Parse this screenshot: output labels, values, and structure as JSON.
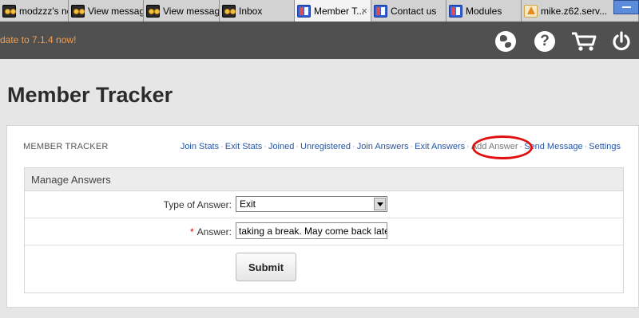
{
  "browser": {
    "tabs": [
      {
        "label": "modzzz's ne...",
        "icon": "eye-icon",
        "active": false
      },
      {
        "label": "View message",
        "icon": "eye-icon",
        "active": false
      },
      {
        "label": "View message",
        "icon": "eye-icon",
        "active": false
      },
      {
        "label": "Inbox",
        "icon": "eye-icon",
        "active": false
      },
      {
        "label": "Member T...",
        "icon": "window-icon",
        "active": true,
        "close": "×"
      },
      {
        "label": "Contact us",
        "icon": "window-icon",
        "active": false
      },
      {
        "label": "Modules",
        "icon": "window-icon",
        "active": false
      },
      {
        "label": "mike.z62.serv...",
        "icon": "phpmyadmin-icon",
        "active": false
      }
    ]
  },
  "appbar": {
    "update_notice": "date to 7.1.4 now!",
    "icons": [
      "globe-icon",
      "help-icon",
      "cart-icon",
      "power-icon"
    ],
    "help_glyph": "?"
  },
  "page": {
    "title": "Member Tracker"
  },
  "panel": {
    "module_name": "MEMBER TRACKER",
    "nav_links": [
      {
        "label": "Join Stats"
      },
      {
        "label": "Exit Stats"
      },
      {
        "label": "Joined"
      },
      {
        "label": "Unregistered"
      },
      {
        "label": "Join Answers"
      },
      {
        "label": "Exit Answers"
      },
      {
        "label": "Add Answer",
        "current": true
      },
      {
        "label": "Send Message"
      },
      {
        "label": "Settings"
      }
    ],
    "separator": "·",
    "highlight_color": "#e01010"
  },
  "form": {
    "heading": "Manage Answers",
    "type_label": "Type of Answer:",
    "type_value": "Exit",
    "answer_required_mark": "*",
    "answer_label": "Answer:",
    "answer_value": "taking a break. May come back later.",
    "submit_label": "Submit"
  }
}
